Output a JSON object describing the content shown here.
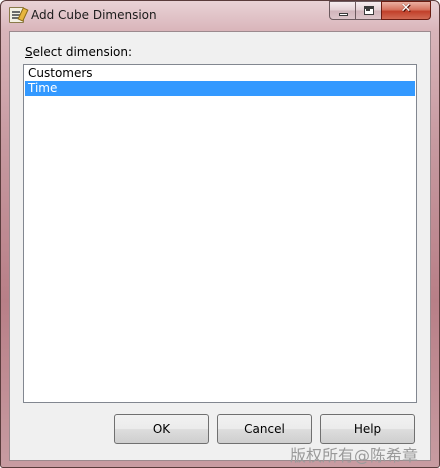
{
  "window": {
    "title": "Add Cube Dimension",
    "icon": "dialog-note-icon",
    "caption_buttons": {
      "minimize_icon": "minimize-icon",
      "maximize_icon": "maximize-icon",
      "close_icon": "close-icon",
      "close_glyph": "✕"
    }
  },
  "dialog": {
    "select_label": "Select dimension:",
    "dimensions": [
      {
        "label": "Customers",
        "selected": false
      },
      {
        "label": "Time",
        "selected": true
      }
    ],
    "buttons": {
      "ok": "OK",
      "cancel": "Cancel",
      "help": "Help"
    }
  },
  "watermark": "版权所有@陈希章",
  "colors": {
    "selection": "#3399ff",
    "close_button": "#c1402a"
  }
}
